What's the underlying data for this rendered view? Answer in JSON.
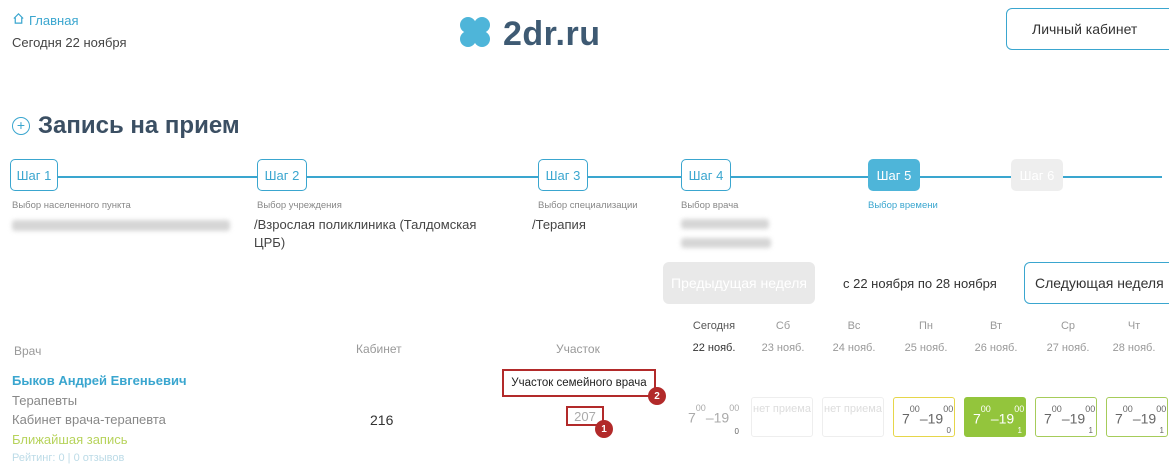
{
  "header": {
    "home_label": "Главная",
    "today_label": "Сегодня 22 ноября",
    "logo_text": "2dr.ru",
    "cabinet_button": "Личный кабинет"
  },
  "page_title": "Запись на прием",
  "steps": [
    {
      "label": "Шаг 1",
      "caption": "Выбор населенного пункта",
      "value": ""
    },
    {
      "label": "Шаг 2",
      "caption": "Выбор учреждения",
      "value": "/Взрослая поликлиника (Талдомская ЦРБ)"
    },
    {
      "label": "Шаг 3",
      "caption": "Выбор специализации",
      "value": "/Терапия"
    },
    {
      "label": "Шаг 4",
      "caption": "Выбор врача",
      "value": ""
    },
    {
      "label": "Шаг 5",
      "caption": "Выбор времени",
      "value": ""
    },
    {
      "label": "Шаг 6",
      "caption": "",
      "value": ""
    }
  ],
  "week_nav": {
    "prev": "Предыдущая неделя",
    "range": "с 22 ноября по 28 ноября",
    "next": "Следующая неделя"
  },
  "columns": {
    "doctor": "Врач",
    "cabinet": "Кабинет",
    "uchastok": "Участок"
  },
  "days": [
    {
      "name": "Сегодня",
      "date": "22 нояб."
    },
    {
      "name": "Сб",
      "date": "23 нояб."
    },
    {
      "name": "Вс",
      "date": "24 нояб."
    },
    {
      "name": "Пн",
      "date": "25 нояб."
    },
    {
      "name": "Вт",
      "date": "26 нояб."
    },
    {
      "name": "Ср",
      "date": "27 нояб."
    },
    {
      "name": "Чт",
      "date": "28 нояб."
    }
  ],
  "doctor": {
    "name": "Быков Андрей Евгеньевич",
    "specialty": "Терапевты",
    "cabinet_type": "Кабинет врача-терапевта",
    "nearest": "Ближайшая запись",
    "rating": "Рейтинг: 0 | 0 отзывов",
    "cabinet": "216",
    "uchastok": "207",
    "uchastok_tooltip": "Участок семейного врача"
  },
  "slots": [
    {
      "from": "7",
      "to": "19",
      "min": "00",
      "count": "0",
      "state": "plain"
    },
    {
      "text": "нет приема",
      "state": "none"
    },
    {
      "text": "нет приема",
      "state": "none"
    },
    {
      "from": "7",
      "to": "19",
      "min": "00",
      "count": "0",
      "state": "yellow"
    },
    {
      "from": "7",
      "to": "19",
      "min": "00",
      "count": "1",
      "state": "green"
    },
    {
      "from": "7",
      "to": "19",
      "min": "00",
      "count": "1",
      "state": "lightgreen"
    },
    {
      "from": "7",
      "to": "19",
      "min": "00",
      "count": "1",
      "state": "lightgreen"
    }
  ],
  "markers": [
    "1",
    "2"
  ],
  "colors": {
    "accent": "#3aa6cf",
    "highlight": "#b22a2a",
    "slot_green": "#93c53c"
  }
}
